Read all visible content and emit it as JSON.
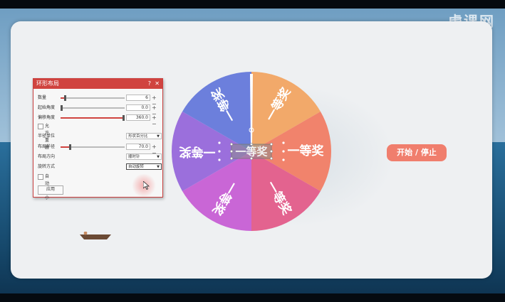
{
  "dialog": {
    "title": "环形布局",
    "help": "?",
    "close": "✕",
    "rows": [
      {
        "label": "数量",
        "value": "6",
        "level": 0.06
      },
      {
        "label": "起始角度",
        "value": "0.0",
        "level": 0.0
      },
      {
        "label": "偏移角度",
        "value": "360.0",
        "level": 1.0
      }
    ],
    "overlap_label": "允许重叠",
    "radius_unit_label": "半径单位",
    "radius_unit_value": "形状百分比",
    "radius_label": "布局半径",
    "radius_value": "70.0",
    "radius_level": 0.14,
    "direction_label": "布局方向",
    "direction_value": "顺时针",
    "rotate_label": "旋转方式",
    "rotate_value": "自动旋转",
    "autosize_label": "自动大小",
    "apply_label": "应用"
  },
  "wheel": {
    "segments": [
      {
        "text": "一等奖",
        "color": "#f2a96a"
      },
      {
        "text": "一等奖",
        "color": "#f1836c"
      },
      {
        "text": "一等奖",
        "color": "#e3638f"
      },
      {
        "text": "一等奖",
        "color": "#c966d6"
      },
      {
        "text": "一等奖",
        "color": "#9b6fdc"
      },
      {
        "text": "一等奖",
        "color": "#6c7fdc"
      }
    ],
    "center_text": "一等奖"
  },
  "start_button": "开始 / 停止",
  "watermark": {
    "brand": "虎课网",
    "sub": "虎课网"
  }
}
